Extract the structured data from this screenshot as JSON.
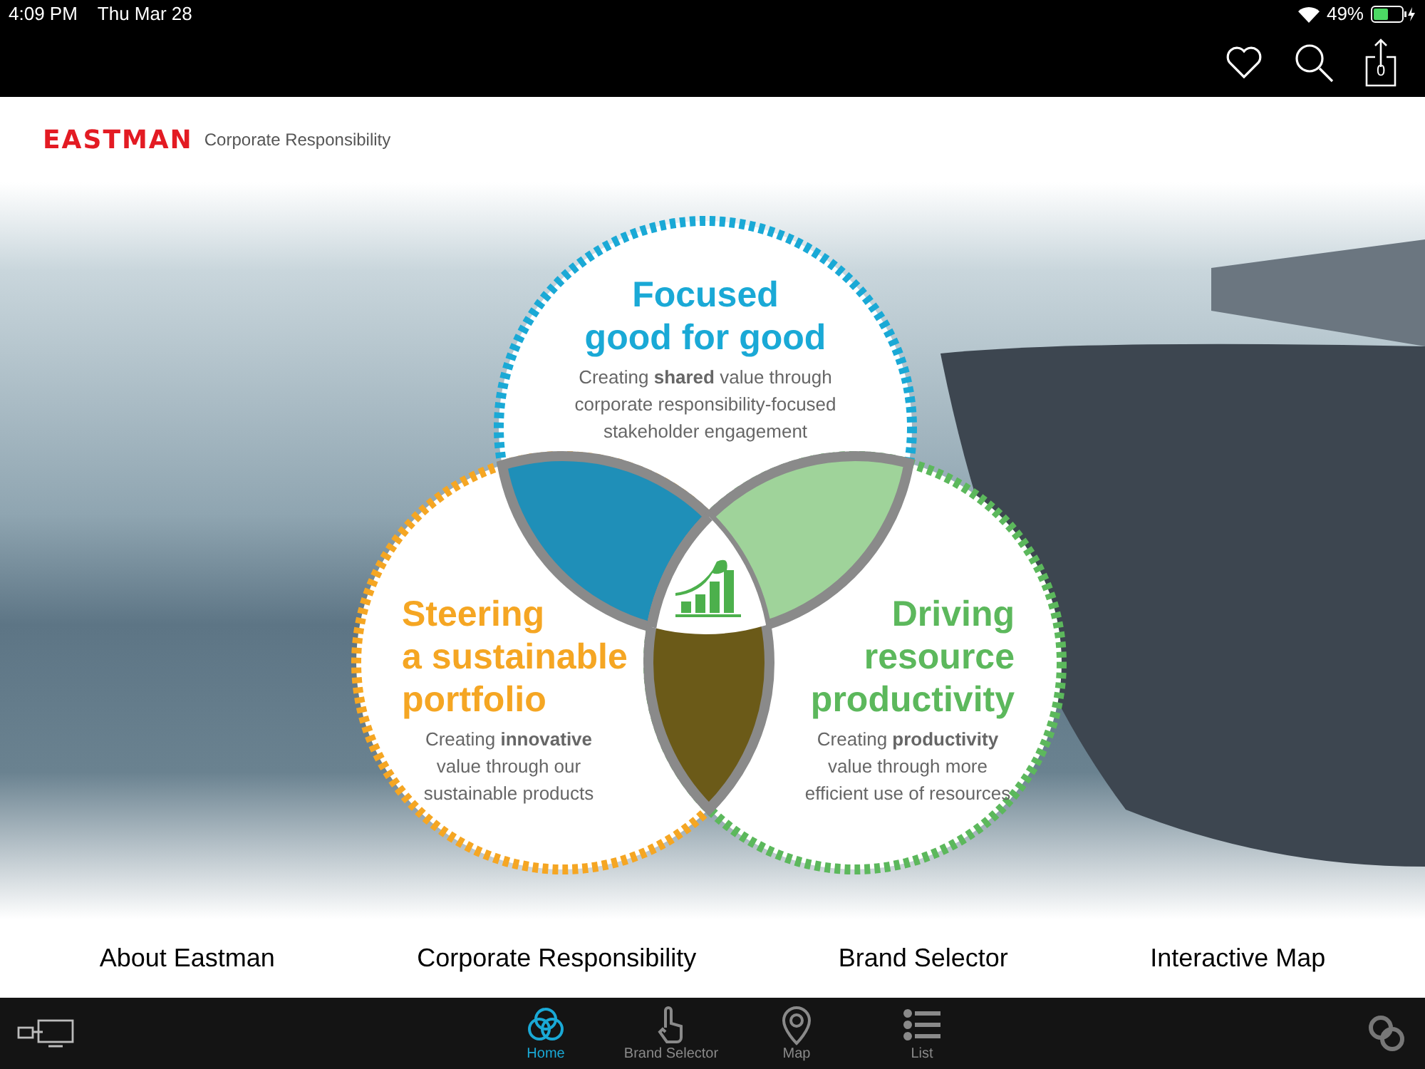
{
  "status_bar": {
    "time": "4:09 PM",
    "date": "Thu Mar 28",
    "battery": "49%"
  },
  "toolbar": {
    "cart_count": "0"
  },
  "header": {
    "brand": "EASTMAN",
    "subtitle": "Corporate Responsibility"
  },
  "venn": [
    {
      "kind": "top",
      "color": "#1aa9d6",
      "title_lines": [
        "Focused",
        "good for good"
      ],
      "description": [
        "Creating **shared** value through",
        "corporate responsibility-focused",
        "stakeholder engagement"
      ]
    },
    {
      "kind": "left",
      "color": "#f5a623",
      "title_lines": [
        "Steering",
        "a sustainable",
        "portfolio"
      ],
      "description": [
        "Creating **innovative**",
        "value through our",
        "sustainable products"
      ]
    },
    {
      "kind": "right",
      "color": "#5cb85c",
      "title_lines": [
        "Driving",
        "resource",
        "productivity"
      ],
      "description": [
        "Creating **productivity**",
        "value through more",
        "efficient use of resources"
      ]
    }
  ],
  "links": [
    "About Eastman",
    "Corporate Responsibility",
    "Brand Selector",
    "Interactive Map"
  ],
  "tabs": [
    {
      "label": "Home",
      "selected": true
    },
    {
      "label": "Brand Selector",
      "selected": false
    },
    {
      "label": "Map",
      "selected": false
    },
    {
      "label": "List",
      "selected": false
    }
  ]
}
